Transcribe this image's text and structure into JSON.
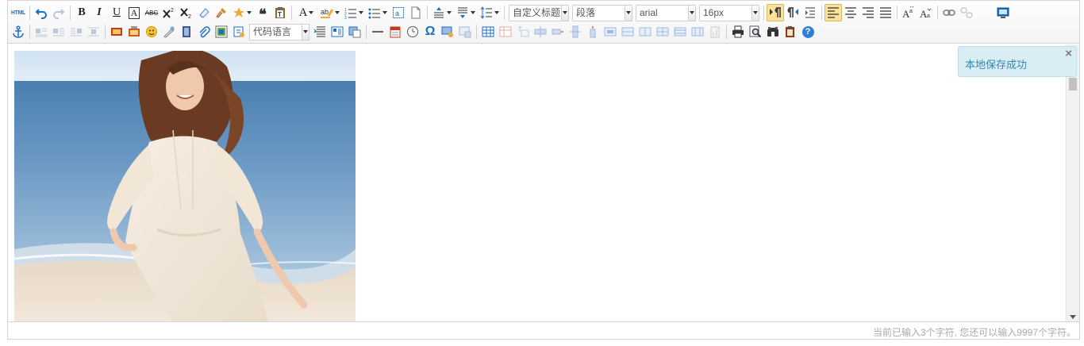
{
  "toolbar": {
    "html_label": "HTML",
    "bold_label": "B",
    "italic_label": "I",
    "underline_label": "U",
    "fontborder_label": "A",
    "strike_label": "ABC",
    "forecolor_label": "A",
    "customstyle": "自定义标题",
    "paragraph": "段落",
    "fontfamily": "arial",
    "fontsize": "16px",
    "insertcode": "代码语言",
    "omega_label": "Ω",
    "help_label": "?"
  },
  "notification": {
    "message": "本地保存成功",
    "close_label": "×"
  },
  "statusbar": {
    "wordcount": "当前已输入3个字符, 您还可以输入9997个字符。"
  },
  "colors": {
    "accent": "#1b6fc2",
    "toast_bg": "#d9edf5",
    "toast_text": "#3a87ad",
    "active_button": "#fbe19a"
  }
}
